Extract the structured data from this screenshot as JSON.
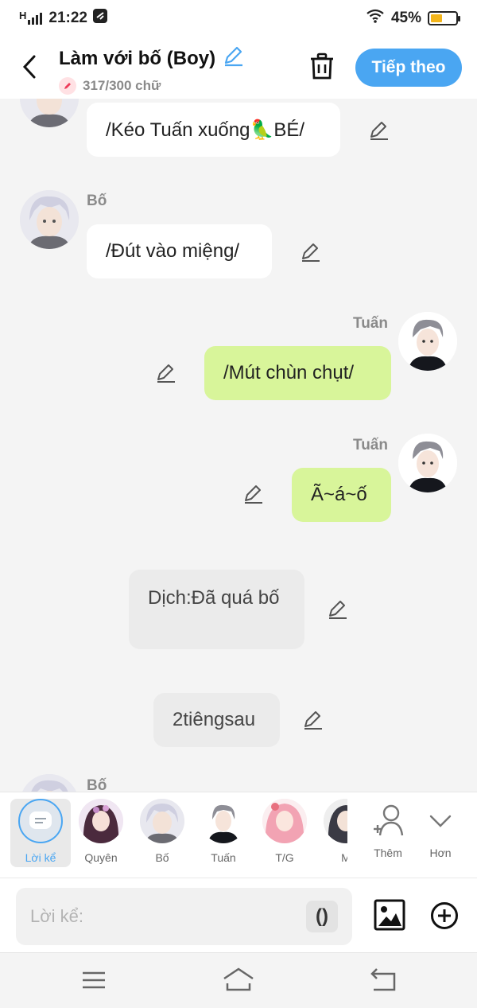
{
  "status": {
    "signal": "H",
    "time": "21:22",
    "battery": "45%",
    "battery_level": 0.45
  },
  "header": {
    "title": "Làm với bố (Boy)",
    "word_count": "317/300 chữ",
    "next_label": "Tiếp theo"
  },
  "messages": [
    {
      "text": "/Kéo Tuấn xuống🦜BÉ/"
    },
    {
      "speaker": "Bố",
      "text": "/Đút vào miệng/"
    },
    {
      "speaker": "Tuấn",
      "text": "/Mút chùn chụt/"
    },
    {
      "speaker": "Tuấn",
      "text": "Ã~á~ố"
    },
    {
      "text": "Dịch:Đã quá bố"
    },
    {
      "text": "2tiêngsau"
    },
    {
      "speaker": "Bố"
    }
  ],
  "characters": [
    {
      "label": "Lời kể"
    },
    {
      "label": "Quyên"
    },
    {
      "label": "Bố"
    },
    {
      "label": "Tuấn"
    },
    {
      "label": "T/G"
    },
    {
      "label": "M"
    },
    {
      "label": "Thêm"
    },
    {
      "label": "Hơn"
    }
  ],
  "input": {
    "placeholder": "Lời kể:",
    "paren_label": "()"
  },
  "colors": {
    "accent": "#4aa6f2",
    "green_bubble": "#d8f59a",
    "battery": "#f3b51b"
  }
}
